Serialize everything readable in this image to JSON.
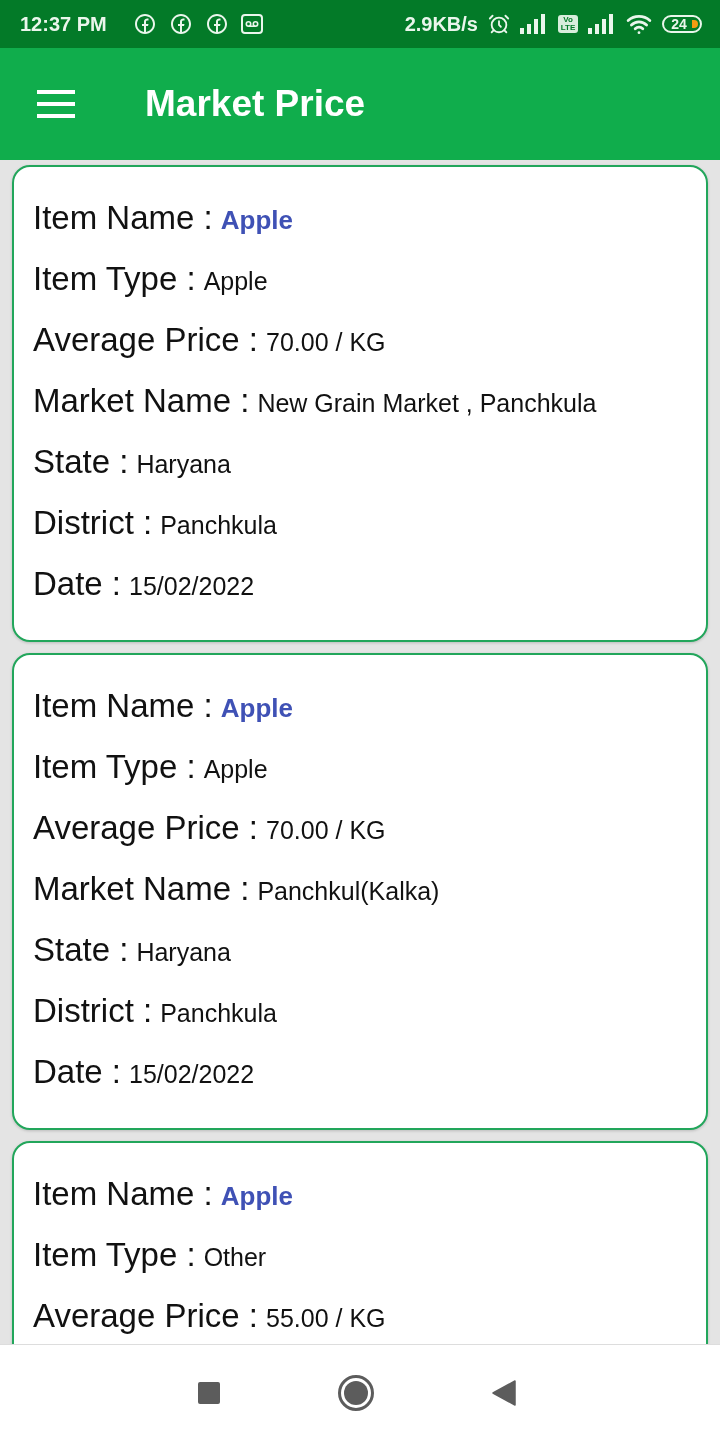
{
  "status_bar": {
    "time": "12:37 PM",
    "network_speed": "2.9KB/s",
    "volte_badge": "Vo LTE",
    "battery": "24"
  },
  "app_bar": {
    "title": "Market Price"
  },
  "cards": [
    {
      "fields": [
        {
          "kind": "highlight",
          "label": "Item Name :",
          "value": "Apple"
        },
        {
          "kind": "plain",
          "label": "Item Type :",
          "value": "Apple"
        },
        {
          "kind": "plain",
          "label": "Average Price :",
          "value": "70.00 / KG"
        },
        {
          "kind": "plain",
          "label": "Market Name :",
          "value": "New Grain Market , Panchkula"
        },
        {
          "kind": "plain",
          "label": "State :",
          "value": "Haryana"
        },
        {
          "kind": "plain",
          "label": "District :",
          "value": "Panchkula"
        },
        {
          "kind": "plain",
          "label": "Date :",
          "value": "15/02/2022"
        }
      ]
    },
    {
      "fields": [
        {
          "kind": "highlight",
          "label": "Item Name :",
          "value": "Apple"
        },
        {
          "kind": "plain",
          "label": "Item Type :",
          "value": "Apple"
        },
        {
          "kind": "plain",
          "label": "Average Price :",
          "value": "70.00 / KG"
        },
        {
          "kind": "plain",
          "label": "Market Name :",
          "value": "Panchkul(Kalka)"
        },
        {
          "kind": "plain",
          "label": "State :",
          "value": "Haryana"
        },
        {
          "kind": "plain",
          "label": "District :",
          "value": "Panchkula"
        },
        {
          "kind": "plain",
          "label": "Date :",
          "value": "15/02/2022"
        }
      ]
    },
    {
      "fields": [
        {
          "kind": "highlight",
          "label": "Item Name :",
          "value": "Apple"
        },
        {
          "kind": "plain",
          "label": "Item Type :",
          "value": "Other"
        },
        {
          "kind": "plain",
          "label": "Average Price :",
          "value": "55.00 / KG"
        }
      ]
    }
  ]
}
